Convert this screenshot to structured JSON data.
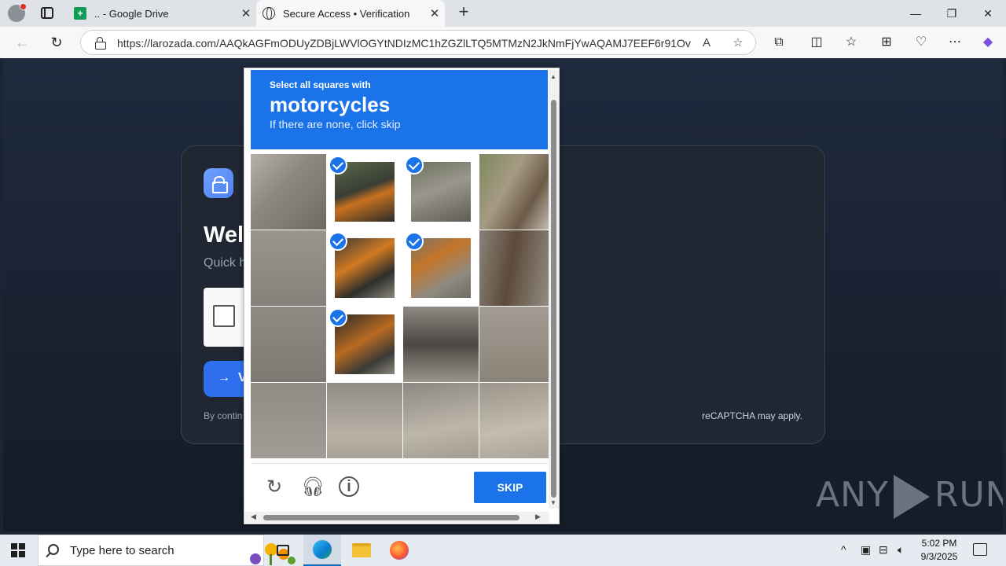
{
  "browser": {
    "tabs": [
      {
        "label": ".. - Google Drive",
        "icon": "sheets-icon"
      },
      {
        "label": "Secure Access • Verification",
        "icon": "globe-icon",
        "active": true
      }
    ],
    "url": "https://larozada.com/AAQkAGFmODUyZDBjLWVlOGYtNDIzMC1hZGZlLTQ5MTMzN2JkNmFjYwAQAMJ7EEF6r91Ovo..."
  },
  "page": {
    "title_visible": "Wel",
    "subtitle_visible": "Quick h",
    "verify_arrow": "→",
    "verify_visible": "V",
    "footer_left_visible": "By contin",
    "footer_right": "reCAPTCHA may apply.",
    "watermark": {
      "left": "ANY",
      "right": "RUN"
    }
  },
  "captcha": {
    "instruction": "Select all squares with",
    "target": "motorcycles",
    "hint": "If there are none, click skip",
    "selected_tiles": [
      1,
      2,
      5,
      6,
      9
    ],
    "skip_label": "SKIP",
    "footer_icons": [
      "reload-icon",
      "audio-icon",
      "info-icon"
    ]
  },
  "taskbar": {
    "search_placeholder": "Type here to search",
    "time": "5:02 PM",
    "date": "9/3/2025"
  }
}
